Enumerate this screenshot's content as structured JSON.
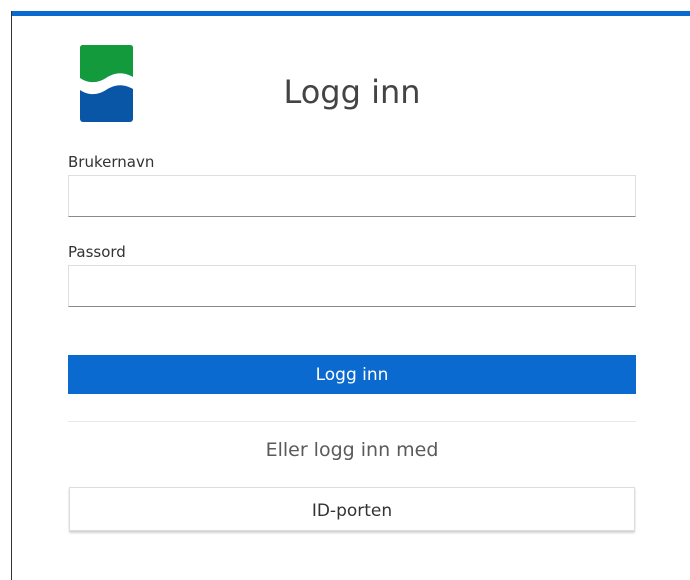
{
  "colors": {
    "accent": "#0a6ad0",
    "logo_green": "#129a3d",
    "logo_blue": "#0a56a6",
    "text": "#444444"
  },
  "logo": {
    "icon": "municipal-logo-icon"
  },
  "header": {
    "title": "Logg inn"
  },
  "form": {
    "username_label": "Brukernavn",
    "username_value": "",
    "username_placeholder": "",
    "password_label": "Passord",
    "password_value": "",
    "password_placeholder": "",
    "submit_label": "Logg inn"
  },
  "alternative": {
    "text": "Eller logg inn med",
    "idporten_label": "ID-porten"
  }
}
